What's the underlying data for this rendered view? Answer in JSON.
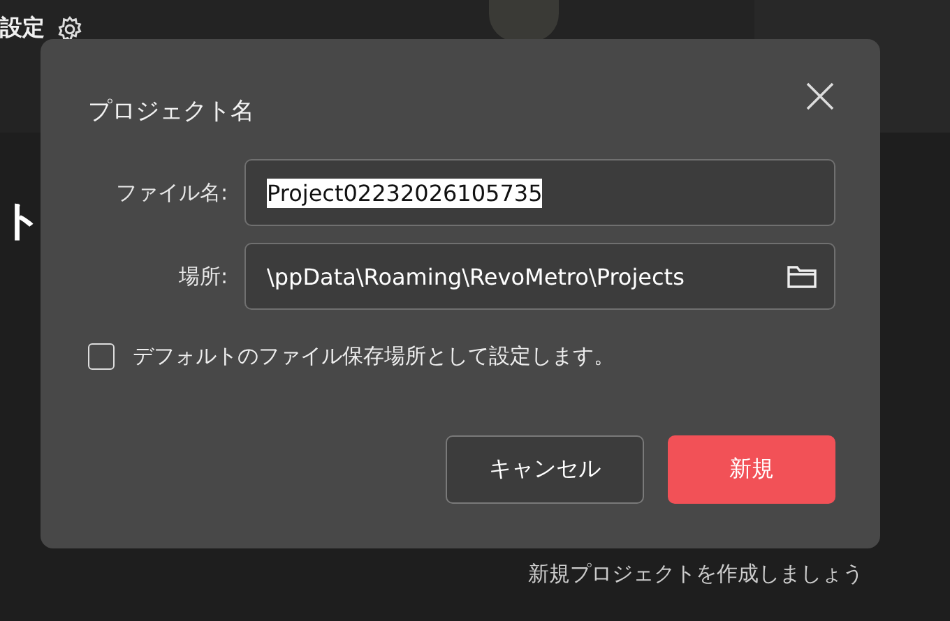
{
  "background": {
    "settings_label": "設定",
    "heading_fragment": "ト",
    "hint": "新規プロジェクトを作成しましょう"
  },
  "dialog": {
    "title": "プロジェクト名",
    "fields": [
      {
        "label": "ファイル名:",
        "value": "Project02232026105735",
        "value_selected": true,
        "kind": "text"
      },
      {
        "label": "場所:",
        "value": "\\ppData\\Roaming\\RevoMetro\\Projects",
        "value_selected": false,
        "kind": "folder"
      }
    ],
    "checkbox": {
      "label": "デフォルトのファイル保存場所として設定します。",
      "checked": false
    },
    "buttons": [
      {
        "label": "キャンセル",
        "kind": "secondary"
      },
      {
        "label": "新規",
        "kind": "primary"
      }
    ]
  }
}
